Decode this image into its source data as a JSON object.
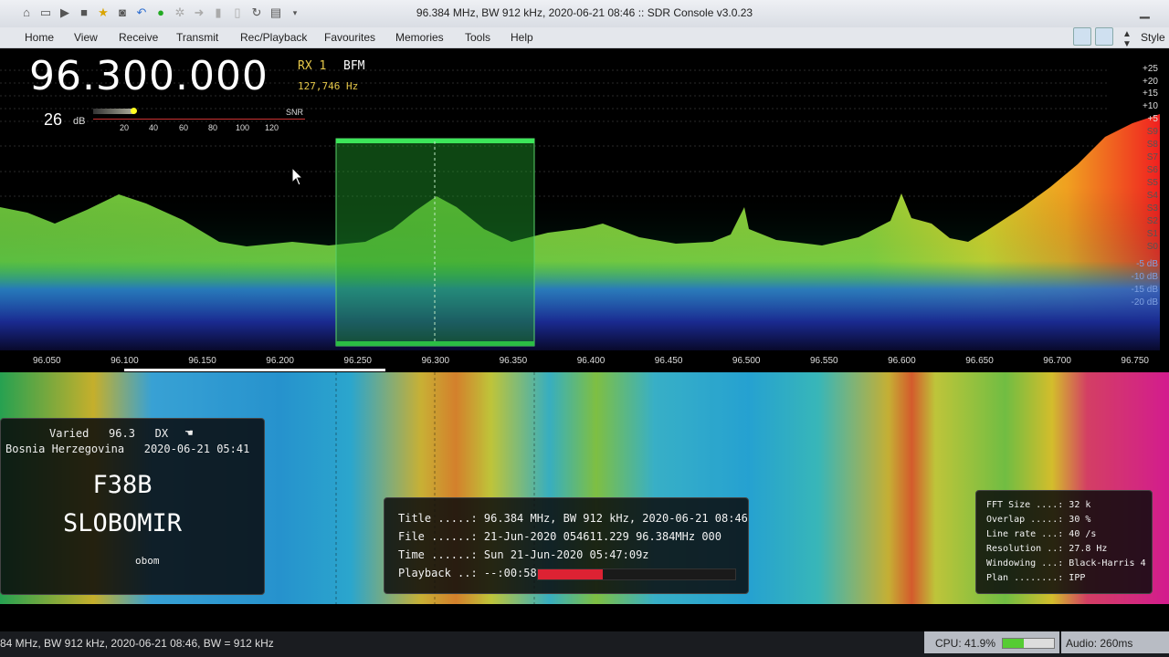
{
  "window": {
    "title": "96.384 MHz, BW 912 kHz, 2020-06-21 08:46 :: SDR Console v3.0.23",
    "controls": {
      "minimize": "▁",
      "close": "✕"
    }
  },
  "menu": {
    "items": [
      "Home",
      "View",
      "Receive",
      "Transmit",
      "Rec/Playback",
      "Favourites",
      "Memories",
      "Tools",
      "Help"
    ],
    "style_label": "Style"
  },
  "receiver": {
    "frequency": "96.300.000",
    "rx": "RX 1",
    "mode": "BFM",
    "offset": "127,746 Hz",
    "level_value": "26",
    "level_unit": "dB",
    "snr_label": "SNR",
    "snr_ticks": [
      "20",
      "40",
      "60",
      "80",
      "100",
      "120"
    ]
  },
  "spectrum": {
    "db_labels": [
      "+25",
      "+20",
      "+15",
      "+10",
      "+5",
      "S9",
      "S8",
      "S7",
      "S6",
      "S5",
      "S4",
      "S3",
      "S2",
      "S1",
      "S0",
      "-5 dB",
      "-10 dB",
      "-15 dB",
      "-20 dB"
    ],
    "freq_labels": [
      "96.050",
      "96.100",
      "96.150",
      "96.200",
      "96.250",
      "96.300",
      "96.350",
      "96.400",
      "96.450",
      "96.500",
      "96.550",
      "96.600",
      "96.650",
      "96.700",
      "96.750"
    ]
  },
  "rds": {
    "line1": "Varied   96.3   DX",
    "line2": "Bosnia Herzegovina   2020-06-21 05:41",
    "ps1": "F38B",
    "ps2": "SLOBOMIR",
    "rt": "obom"
  },
  "file_info": {
    "title": "Title .....: 96.384 MHz, BW 912 kHz, 2020-06-21 08:46",
    "file": "File ......: 21-Jun-2020 054611.229 96.384MHz 000",
    "time": "Time ......: Sun 21-Jun-2020 05:47:09z",
    "playback": "Playback ..: --:00:58",
    "playback_progress": 0.33
  },
  "fft_info": {
    "fft_size": "FFT Size ....: 32 k",
    "overlap": "Overlap .....: 30 %",
    "line_rate": "Line rate ...: 40 /s",
    "resolution": "Resolution ..: 27.8 Hz",
    "windowing": "Windowing ...: Black-Harris 4",
    "plan": "Plan ........: IPP"
  },
  "status": {
    "text": "84 MHz, BW 912 kHz, 2020-06-21 08:46, BW = 912 kHz",
    "cpu": "CPU: 41.9%",
    "cpu_value": 0.419,
    "audio": "Audio: 260ms"
  }
}
